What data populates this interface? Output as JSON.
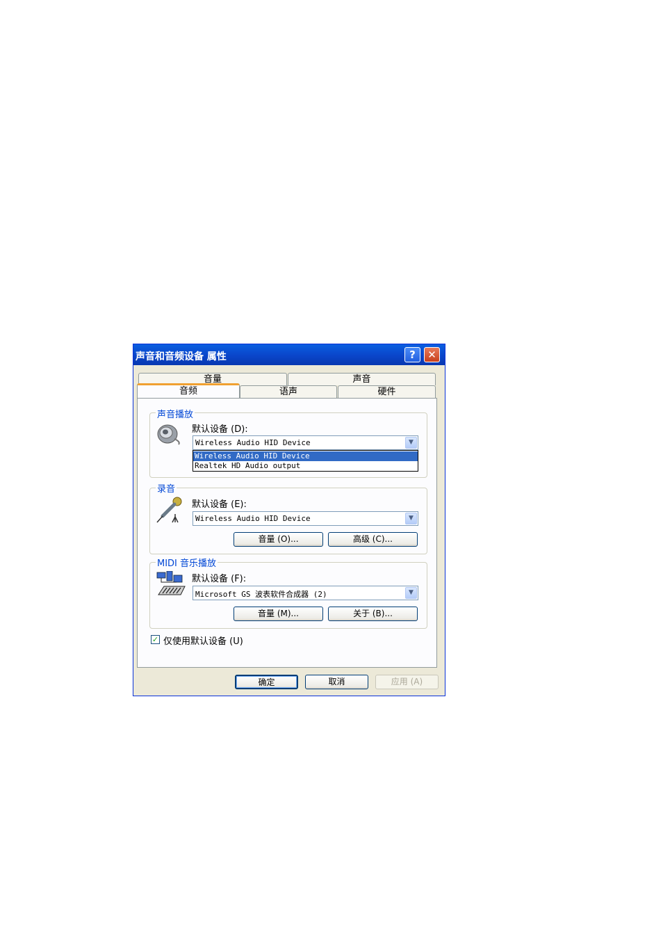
{
  "dialog": {
    "title": "声音和音频设备 属性",
    "help_icon": "?",
    "close_icon": "✕"
  },
  "tabs": {
    "row1": [
      "音量",
      "声音"
    ],
    "row2": [
      "音频",
      "语声",
      "硬件"
    ],
    "active": "音频"
  },
  "playback": {
    "group_title": "声音播放",
    "icon": "speaker-icon",
    "label": "默认设备 (D):",
    "selected": "Wireless Audio HID Device",
    "options": [
      "Wireless Audio HID Device",
      "Realtek HD Audio output"
    ]
  },
  "recording": {
    "group_title": "录音",
    "icon": "microphone-icon",
    "label": "默认设备 (E):",
    "selected": "Wireless Audio HID Device",
    "volume_button": "音量 (O)...",
    "advanced_button": "高级 (C)..."
  },
  "midi": {
    "group_title": "MIDI 音乐播放",
    "icon": "midi-keyboard-icon",
    "label": "默认设备 (F):",
    "selected": "Microsoft GS 波表软件合成器 (2)",
    "volume_button": "音量 (M)...",
    "about_button": "关于 (B)..."
  },
  "use_default_only": {
    "label": "仅使用默认设备 (U)",
    "checked": true
  },
  "footer": {
    "ok": "确定",
    "cancel": "取消",
    "apply": "应用 (A)"
  },
  "colors": {
    "titlebar": "#0a47cc",
    "group_title": "#0046d5",
    "selection": "#316ac5",
    "dialog_bg": "#ece9d8"
  }
}
